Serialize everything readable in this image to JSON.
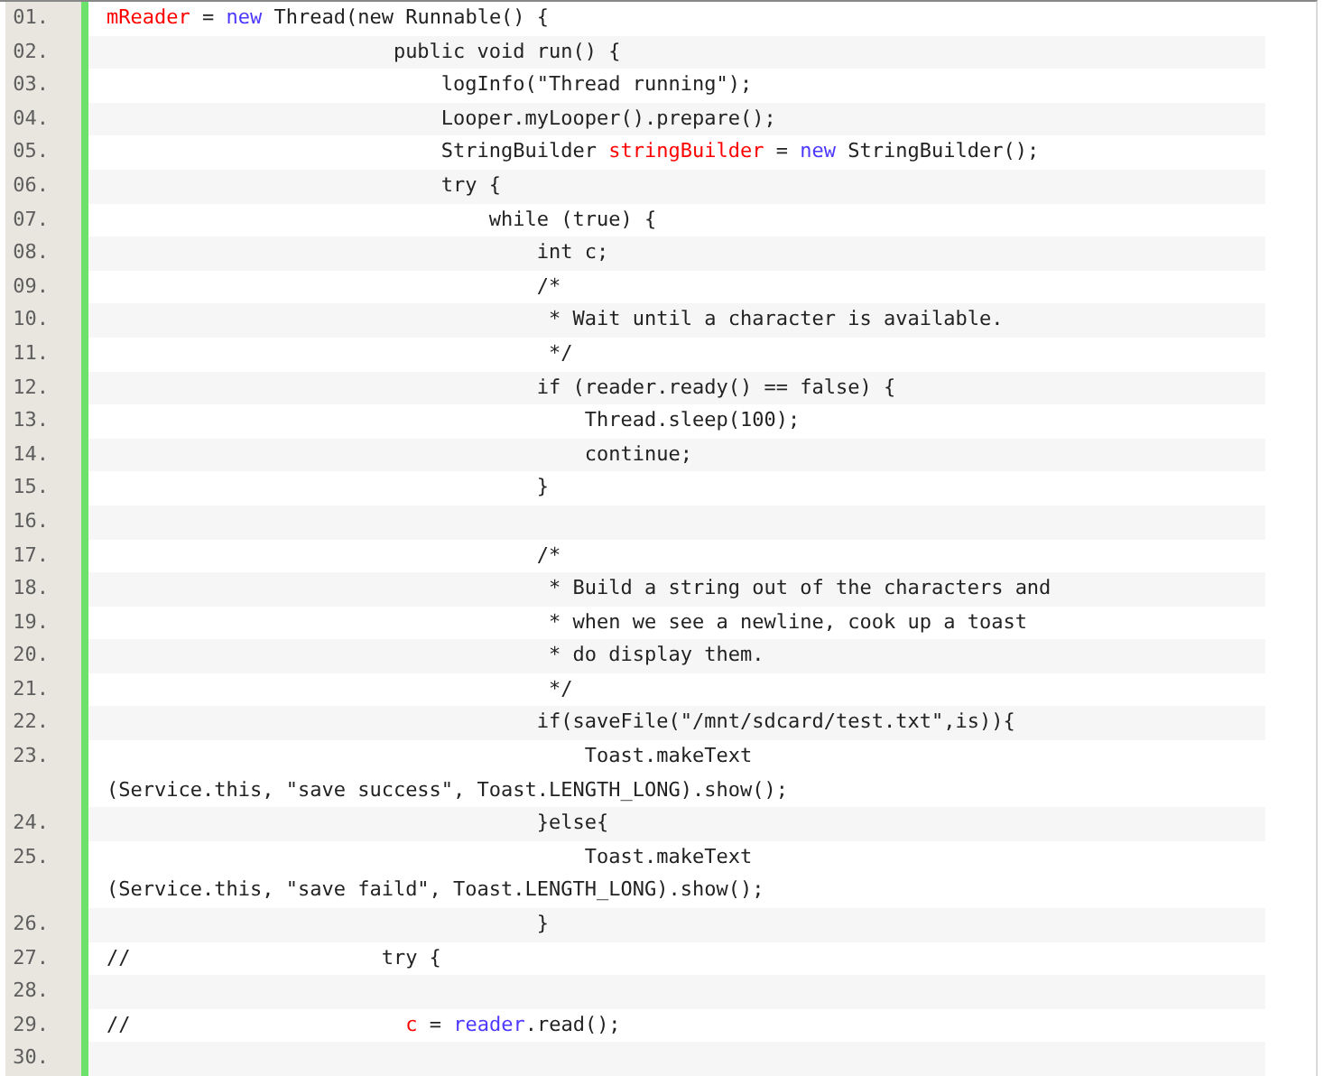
{
  "lines": [
    {
      "number": "01.",
      "tokens": [
        {
          "kind": "variable",
          "text": "mReader"
        },
        {
          "kind": "plain",
          "text": " = "
        },
        {
          "kind": "keyword",
          "text": "new"
        },
        {
          "kind": "plain",
          "text": " Thread(new Runnable() {"
        }
      ]
    },
    {
      "number": "02.",
      "tokens": [
        {
          "kind": "plain",
          "text": "                        public void run() {"
        }
      ]
    },
    {
      "number": "03.",
      "tokens": [
        {
          "kind": "plain",
          "text": "                            logInfo(\"Thread running\");"
        }
      ]
    },
    {
      "number": "04.",
      "tokens": [
        {
          "kind": "plain",
          "text": "                            Looper.myLooper().prepare();"
        }
      ]
    },
    {
      "number": "05.",
      "tokens": [
        {
          "kind": "plain",
          "text": "                            StringBuilder "
        },
        {
          "kind": "variable",
          "text": "stringBuilder"
        },
        {
          "kind": "plain",
          "text": " = "
        },
        {
          "kind": "keyword",
          "text": "new"
        },
        {
          "kind": "plain",
          "text": " StringBuilder();"
        }
      ]
    },
    {
      "number": "06.",
      "tokens": [
        {
          "kind": "plain",
          "text": "                            try {"
        }
      ]
    },
    {
      "number": "07.",
      "tokens": [
        {
          "kind": "plain",
          "text": "                                while (true) {"
        }
      ]
    },
    {
      "number": "08.",
      "tokens": [
        {
          "kind": "plain",
          "text": "                                    int c;"
        }
      ]
    },
    {
      "number": "09.",
      "tokens": [
        {
          "kind": "plain",
          "text": "                                    /*"
        }
      ]
    },
    {
      "number": "10.",
      "tokens": [
        {
          "kind": "plain",
          "text": "                                     * Wait until a character is available."
        }
      ]
    },
    {
      "number": "11.",
      "tokens": [
        {
          "kind": "plain",
          "text": "                                     */"
        }
      ]
    },
    {
      "number": "12.",
      "tokens": [
        {
          "kind": "plain",
          "text": "                                    if (reader.ready() == false) {"
        }
      ]
    },
    {
      "number": "13.",
      "tokens": [
        {
          "kind": "plain",
          "text": "                                        Thread.sleep(100);"
        }
      ]
    },
    {
      "number": "14.",
      "tokens": [
        {
          "kind": "plain",
          "text": "                                        continue;"
        }
      ]
    },
    {
      "number": "15.",
      "tokens": [
        {
          "kind": "plain",
          "text": "                                    }"
        }
      ]
    },
    {
      "number": "16."
    },
    {
      "number": "17.",
      "tokens": [
        {
          "kind": "plain",
          "text": "                                    /*"
        }
      ]
    },
    {
      "number": "18.",
      "tokens": [
        {
          "kind": "plain",
          "text": "                                     * Build a string out of the characters and"
        }
      ]
    },
    {
      "number": "19.",
      "tokens": [
        {
          "kind": "plain",
          "text": "                                     * when we see a newline, cook up a toast"
        }
      ]
    },
    {
      "number": "20.",
      "tokens": [
        {
          "kind": "plain",
          "text": "                                     * do display them."
        }
      ]
    },
    {
      "number": "21.",
      "tokens": [
        {
          "kind": "plain",
          "text": "                                     */"
        }
      ]
    },
    {
      "number": "22.",
      "tokens": [
        {
          "kind": "plain",
          "text": "                                    if(saveFile(\"/mnt/sdcard/test.txt\",is)){"
        }
      ]
    },
    {
      "number": "23.",
      "tokens": [
        {
          "kind": "plain",
          "text": "                                        Toast.makeText"
        }
      ],
      "continuation": "(Service.this, \"save success\", Toast.LENGTH_LONG).show();"
    },
    {
      "number": "24.",
      "tokens": [
        {
          "kind": "plain",
          "text": "                                    }else{"
        }
      ]
    },
    {
      "number": "25.",
      "tokens": [
        {
          "kind": "plain",
          "text": "                                        Toast.makeText"
        }
      ],
      "continuation": "(Service.this, \"save faild\", Toast.LENGTH_LONG).show();"
    },
    {
      "number": "26.",
      "tokens": [
        {
          "kind": "plain",
          "text": "                                    }"
        }
      ]
    },
    {
      "number": "27.",
      "tokens": [
        {
          "kind": "plain",
          "text": "//                     try {"
        }
      ]
    },
    {
      "number": "28."
    },
    {
      "number": "29.",
      "tokens": [
        {
          "kind": "plain",
          "text": "//                       "
        },
        {
          "kind": "variable",
          "text": "c"
        },
        {
          "kind": "plain",
          "text": " = "
        },
        {
          "kind": "keyword",
          "text": "reader"
        },
        {
          "kind": "plain",
          "text": ".read();"
        }
      ]
    },
    {
      "number": "30."
    }
  ]
}
